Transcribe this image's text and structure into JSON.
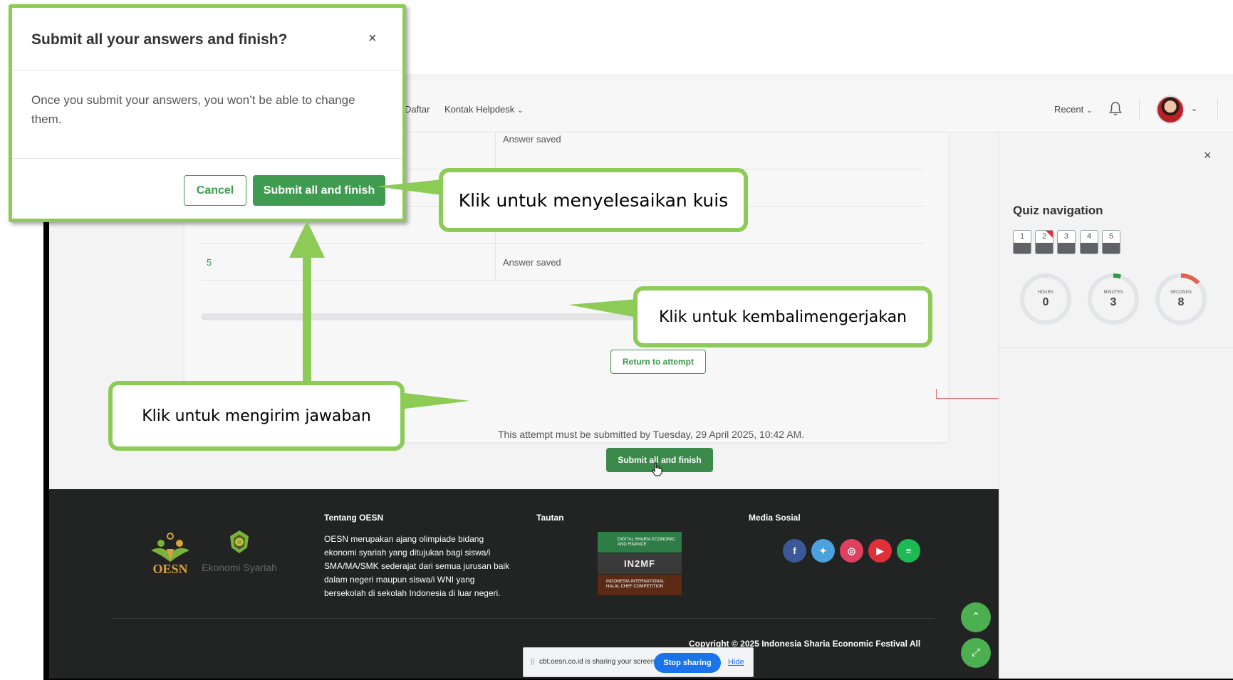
{
  "navbar": {
    "links": [
      {
        "label": "Daftar"
      },
      {
        "label": "Kontak Helpdesk",
        "has_dropdown": true
      }
    ],
    "recent_label": "Recent",
    "chevron": "⌄",
    "bell_icon": "bell-icon",
    "avatar_icon": "user-avatar"
  },
  "summary": {
    "rows": [
      {
        "num": "",
        "status": "Answer saved"
      },
      {
        "num": "",
        "status": ""
      },
      {
        "num": "",
        "status": ""
      },
      {
        "num": "5",
        "status": "Answer saved"
      }
    ],
    "return_label": "Return to attempt",
    "deadline": "This attempt must be submitted by Tuesday, 29 April 2025, 10:42 AM.",
    "submit_label": "Submit all and finish"
  },
  "drawer": {
    "close": "×",
    "title": "Quiz navigation",
    "questions": [
      {
        "num": "1",
        "flagged": false
      },
      {
        "num": "2",
        "flagged": true
      },
      {
        "num": "3",
        "flagged": false
      },
      {
        "num": "4",
        "flagged": false
      },
      {
        "num": "5",
        "flagged": false
      }
    ],
    "timer": [
      {
        "label": "HOURS",
        "value": "0",
        "fraction": 0,
        "color": "#cfd3d8"
      },
      {
        "label": "MINUTES",
        "value": "3",
        "fraction": 0.05,
        "color": "#2e9a4e"
      },
      {
        "label": "SECONDS",
        "value": "8",
        "fraction": 0.13,
        "color": "#e0634f"
      }
    ]
  },
  "footer": {
    "logo_text": "OESN",
    "logo2_text": "Ekonomi Syariah",
    "about_heading": "Tentang OESN",
    "about_text": "OESN merupakan ajang olimpiade bidang ekonomi syariah yang ditujukan bagi siswa/i SMA/MA/SMK sederajat dari semua jurusan baik dalam negeri maupun siswa/i WNI yang bersekolah di sekolah Indonesia di luar negeri.",
    "links_heading": "Tautan",
    "sponsors": [
      {
        "label": "DIGITAL SHARIA ECONOMIC AND FINANCE",
        "color": "#2e7d46"
      },
      {
        "label": "IN2MF",
        "color": "#3a3a3a"
      },
      {
        "label": "INDONESIA INTERNATIONAL HALAL CHEF COMPETITION",
        "color": "#5a2a14"
      }
    ],
    "social_heading": "Media Sosial",
    "social": [
      {
        "icon": "facebook-icon",
        "glyph": "f",
        "color": "#3b5998"
      },
      {
        "icon": "twitter-icon",
        "glyph": "✦",
        "color": "#4aa3df"
      },
      {
        "icon": "instagram-icon",
        "glyph": "◎",
        "color": "#e0405f"
      },
      {
        "icon": "youtube-icon",
        "glyph": "▶",
        "color": "#e0303a"
      },
      {
        "icon": "spotify-icon",
        "glyph": "≡",
        "color": "#1db954"
      }
    ],
    "copyright": "Copyright © 2025 Indonesia Sharia Economic Festival All",
    "fab_up": "⌃",
    "fab_expand": "⤢"
  },
  "share_bar": {
    "text": "cbt.oesn.co.id is sharing your screen.",
    "stop_label": "Stop sharing",
    "hide_label": "Hide"
  },
  "modal": {
    "title": "Submit all your answers and finish?",
    "close": "×",
    "body": "Once you submit your answers, you won’t be able to change them.",
    "cancel_label": "Cancel",
    "submit_label": "Submit all and finish"
  },
  "callouts": {
    "finish": "Klik untuk menyelesaikan kuis",
    "return": "Klik untuk kembalimengerjakan",
    "send": "Klik untuk mengirim jawaban"
  },
  "colors": {
    "accent_green": "#3f9b4f",
    "callout_green": "#8ccb55",
    "footer_bg": "#222423"
  }
}
